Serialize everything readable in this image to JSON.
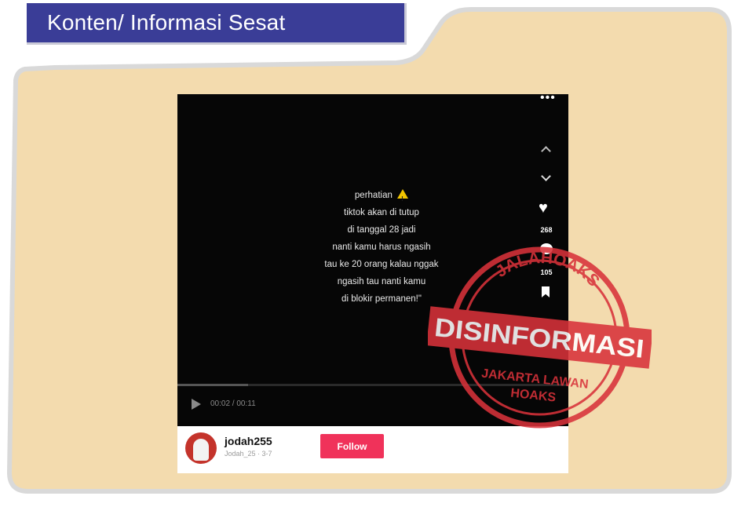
{
  "title": "Konten/ Informasi Sesat",
  "colors": {
    "card_bg": "#f3dbae",
    "card_border": "#d9d9d9",
    "title_bg": "#3a3d97",
    "stamp_red": "#d8323a",
    "follow_bg": "#f0325a"
  },
  "tiktok": {
    "caption_lines": [
      "perhatian",
      "tiktok akan di tutup",
      "di tanggal 28 jadi",
      "nanti kamu harus ngasih",
      "tau ke 20 orang kalau nggak",
      "ngasih tau nanti kamu",
      "di blokir permanen!\""
    ],
    "more_icon": "•••",
    "like_count": "268",
    "comment_count": "105",
    "time": "00:02 / 00:11",
    "progress": 0.18,
    "username": "jodah255",
    "subname": "Jodah_25 · 3-7",
    "follow_label": "Follow"
  },
  "stamp": {
    "top": "JALAHOAKS",
    "middle": "DISINFORMASI",
    "bottom_line1": "JAKARTA LAWAN",
    "bottom_line2": "HOAKS"
  }
}
